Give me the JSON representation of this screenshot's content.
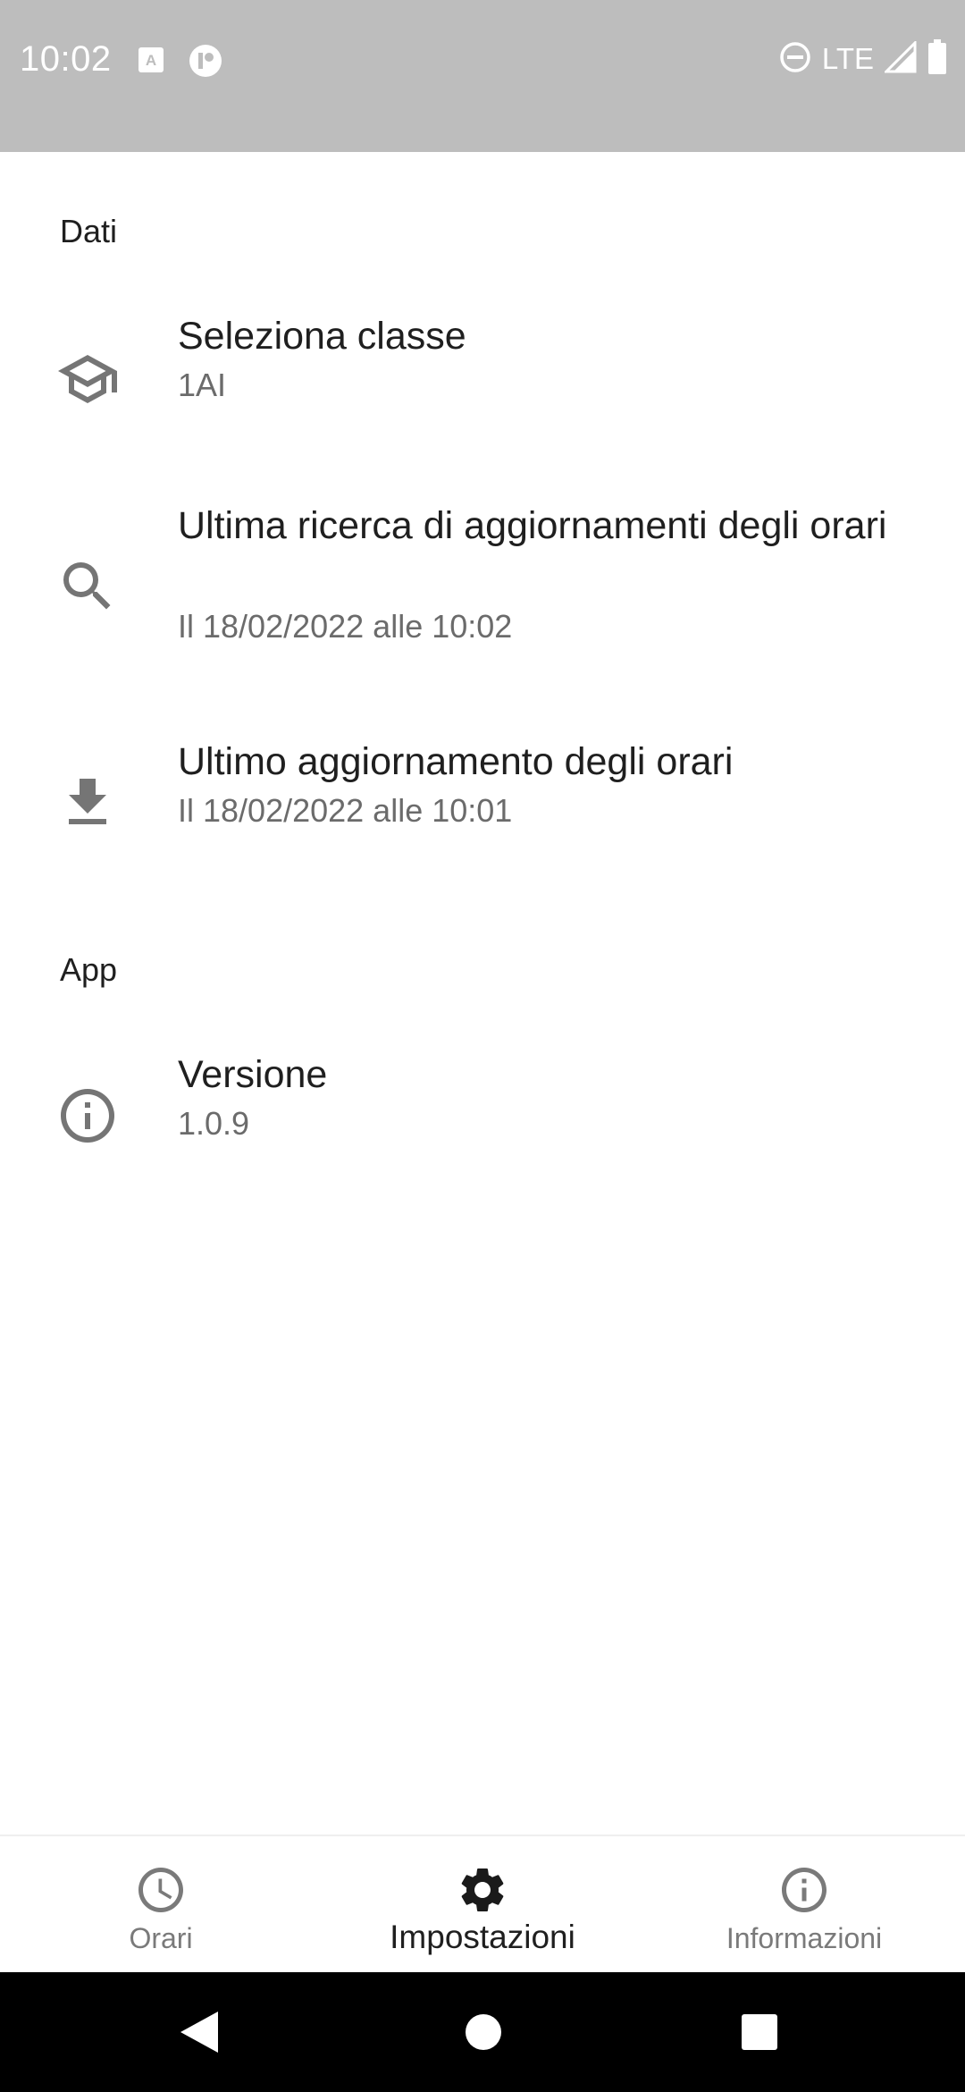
{
  "status_bar": {
    "time": "10:02",
    "network": "LTE",
    "icons": [
      "font-a-icon",
      "assistant-icon",
      "do-not-disturb-icon",
      "signal-icon",
      "battery-icon"
    ]
  },
  "settings": {
    "sections": [
      {
        "header": "Dati",
        "items": [
          {
            "icon": "school-icon",
            "title": "Seleziona classe",
            "summary": "1AI"
          },
          {
            "icon": "search-icon",
            "title": "Ultima ricerca di aggiornamenti degli orari",
            "summary": "Il 18/02/2022 alle 10:02"
          },
          {
            "icon": "download-icon",
            "title": "Ultimo aggiornamento degli orari",
            "summary": "Il 18/02/2022 alle 10:01"
          }
        ]
      },
      {
        "header": "App",
        "items": [
          {
            "icon": "info-icon",
            "title": "Versione",
            "summary": "1.0.9"
          }
        ]
      }
    ]
  },
  "bottom_nav": {
    "items": [
      {
        "icon": "clock-icon",
        "label": "Orari",
        "active": false
      },
      {
        "icon": "gear-icon",
        "label": "Impostazioni",
        "active": true
      },
      {
        "icon": "info-icon",
        "label": "Informazioni",
        "active": false
      }
    ]
  },
  "system_nav": {
    "buttons": [
      "back-button",
      "home-button",
      "recents-button"
    ]
  },
  "colors": {
    "status_bar": "#bdbdbd",
    "icon_gray": "#757575",
    "active": "#1f1f1f",
    "inactive": "#7a7a7a"
  }
}
